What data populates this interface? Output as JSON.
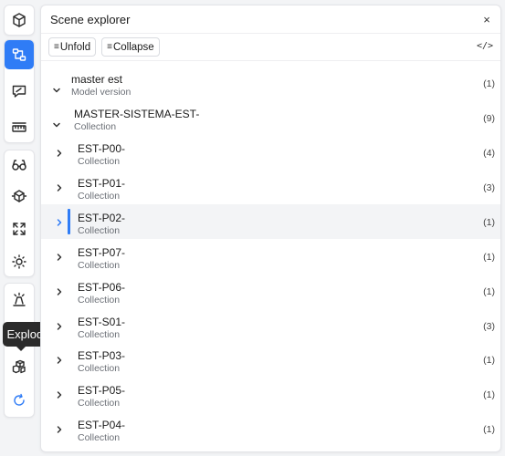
{
  "rail": {
    "tooltip": "Explode model",
    "icons": [
      "cube-icon",
      "scene-tree-icon",
      "comments-icon",
      "measure-ruler-icon",
      "glasses-icon",
      "section-box-icon",
      "fit-screen-icon",
      "sun-light-icon",
      "light-source-icon",
      "explode-model-icon",
      "refresh-icon"
    ],
    "active_color": "#2f7cf6"
  },
  "panel": {
    "title": "Scene explorer",
    "close": "×",
    "toolbar": {
      "unfold_label": "Unfold",
      "collapse_label": "Collapse",
      "code_label": "</>"
    },
    "tree": [
      {
        "name": "master est",
        "sub": "Model version",
        "count": "(1)",
        "expanded": true
      },
      {
        "name": "MASTER-SISTEMA-EST-",
        "sub": "Collection",
        "count": "(9)",
        "expanded": true
      },
      {
        "name": "EST-P00-",
        "sub": "Collection",
        "count": "(4)"
      },
      {
        "name": "EST-P01-",
        "sub": "Collection",
        "count": "(3)"
      },
      {
        "name": "EST-P02-",
        "sub": "Collection",
        "count": "(1)",
        "selected": true
      },
      {
        "name": "EST-P07-",
        "sub": "Collection",
        "count": "(1)"
      },
      {
        "name": "EST-P06-",
        "sub": "Collection",
        "count": "(1)"
      },
      {
        "name": "EST-S01-",
        "sub": "Collection",
        "count": "(3)"
      },
      {
        "name": "EST-P03-",
        "sub": "Collection",
        "count": "(1)"
      },
      {
        "name": "EST-P05-",
        "sub": "Collection",
        "count": "(1)"
      },
      {
        "name": "EST-P04-",
        "sub": "Collection",
        "count": "(1)"
      }
    ]
  }
}
